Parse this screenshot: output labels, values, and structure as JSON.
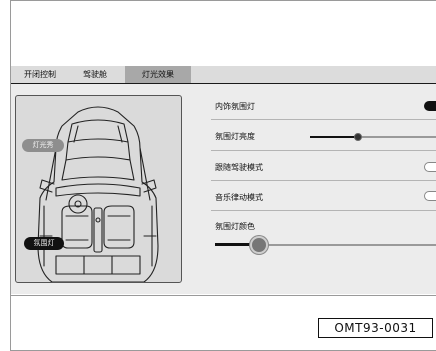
{
  "tabs": [
    {
      "label": "开闭控制",
      "active": false
    },
    {
      "label": "驾驶舱",
      "active": false
    },
    {
      "label": "灯光效果",
      "active": true
    }
  ],
  "car_panel": {
    "light_show_label": "灯光秀",
    "ambient_label": "氛围灯"
  },
  "settings": {
    "interior_ambient": {
      "label": "内饰氛围灯",
      "enabled": true
    },
    "brightness": {
      "label": "氛围灯亮度",
      "level": 0.39
    },
    "drive_follow": {
      "label": "跟随驾驶模式",
      "enabled": false
    },
    "music_rhythm": {
      "label": "音乐律动模式",
      "enabled": false
    },
    "color": {
      "label": "氛围灯颜色",
      "level": 0.2
    }
  },
  "figure_code": "OMT93-0031",
  "colors": {
    "tab_bg": "#dcdcdc",
    "tab_active": "#a8a8a8",
    "panel_bg": "#ececec",
    "on": "#111111"
  }
}
